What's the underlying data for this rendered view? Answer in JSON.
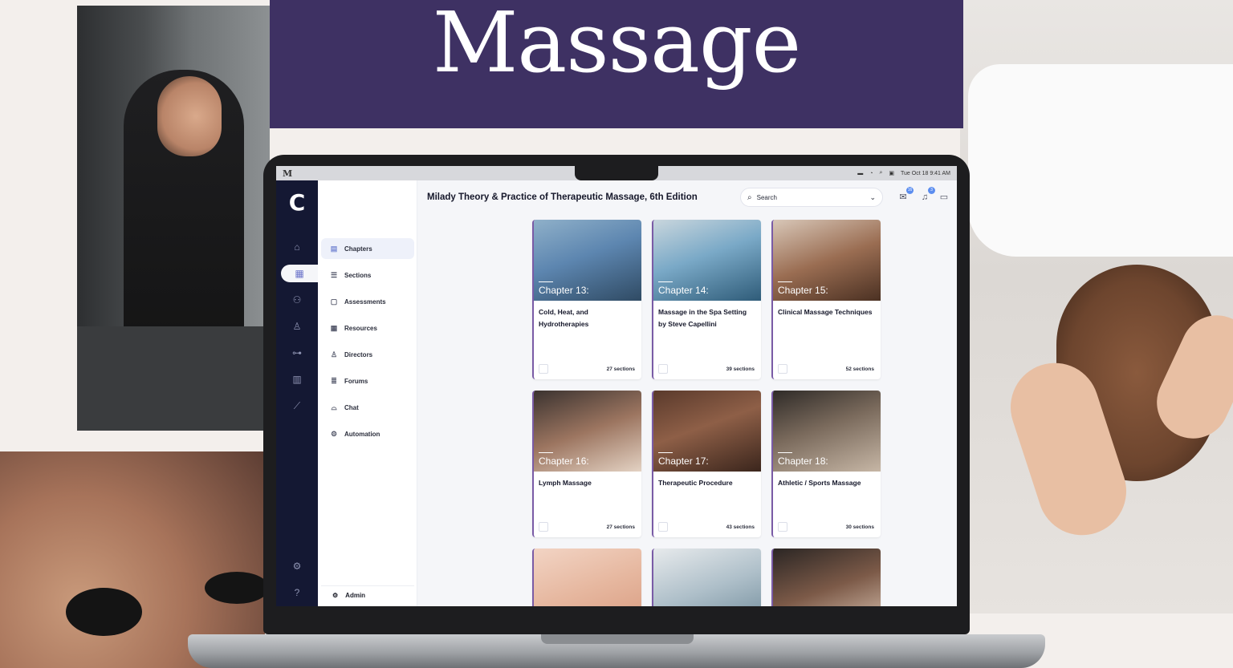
{
  "banner": {
    "title": "Massage"
  },
  "menubar": {
    "logo": "M",
    "datetime": "Tue Oct 18  9:41 AM"
  },
  "app": {
    "logo": "C",
    "title": "Milady Theory & Practice of Therapeutic Massage, 6th Edition",
    "search": {
      "placeholder": "Search"
    },
    "header_icons": [
      {
        "name": "inbox-icon",
        "badge": "16"
      },
      {
        "name": "bell-icon",
        "badge": "3"
      },
      {
        "name": "calendar-icon",
        "badge": ""
      }
    ]
  },
  "rail": {
    "items": [
      {
        "name": "home-icon",
        "glyph": "⌂"
      },
      {
        "name": "courses-icon",
        "glyph": "▦"
      },
      {
        "name": "groups-icon",
        "glyph": "⚇"
      },
      {
        "name": "user-icon",
        "glyph": "♙"
      },
      {
        "name": "hierarchy-icon",
        "glyph": "⊶"
      },
      {
        "name": "library-icon",
        "glyph": "▥"
      },
      {
        "name": "analytics-icon",
        "glyph": "⟋"
      }
    ],
    "bottom": [
      {
        "name": "settings-icon",
        "glyph": "⚙"
      },
      {
        "name": "help-icon",
        "glyph": "?"
      }
    ]
  },
  "subnav": {
    "items": [
      {
        "label": "Chapters",
        "icon": "▤"
      },
      {
        "label": "Sections",
        "icon": "☰"
      },
      {
        "label": "Assessments",
        "icon": "▢"
      },
      {
        "label": "Resources",
        "icon": "▦"
      },
      {
        "label": "Directors",
        "icon": "♙"
      },
      {
        "label": "Forums",
        "icon": "≣"
      },
      {
        "label": "Chat",
        "icon": "⌓"
      },
      {
        "label": "Automation",
        "icon": "⚙"
      }
    ],
    "admin": "Admin"
  },
  "cards": [
    {
      "chapter": "Chapter 13:",
      "title": "Cold, Heat, and Hydrotherapies",
      "sections": "27 sections"
    },
    {
      "chapter": "Chapter 14:",
      "title": "Massage in the Spa Setting by Steve Capellini",
      "sections": "39 sections"
    },
    {
      "chapter": "Chapter 15:",
      "title": "Clinical Massage Techniques",
      "sections": "52 sections"
    },
    {
      "chapter": "Chapter 16:",
      "title": "Lymph Massage",
      "sections": "27 sections"
    },
    {
      "chapter": "Chapter 17:",
      "title": "Therapeutic Procedure",
      "sections": "43 sections"
    },
    {
      "chapter": "Chapter 18:",
      "title": "Athletic / Sports Massage",
      "sections": "30 sections"
    }
  ],
  "colors": {
    "banner": "#3e3163",
    "rail": "#141833",
    "accent": "#7a5ba6",
    "badge": "#5b8def"
  }
}
